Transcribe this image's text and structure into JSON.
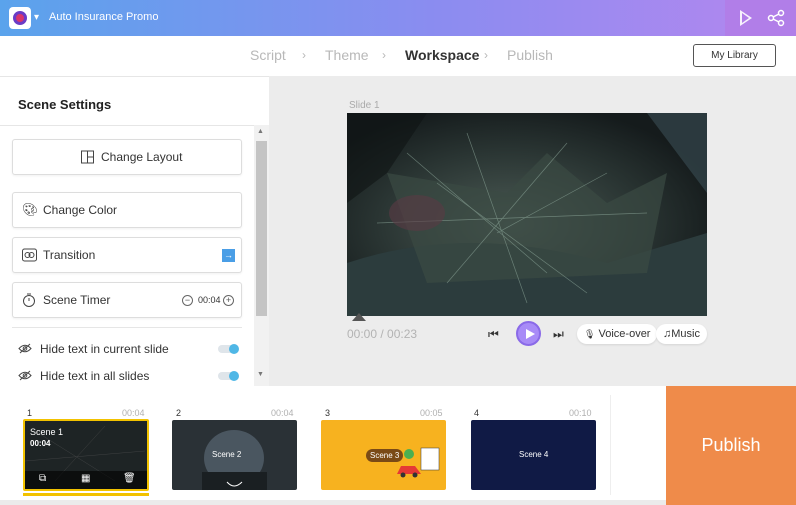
{
  "app": {
    "title": "Auto Insurance Promo"
  },
  "steps": [
    {
      "label": "Script",
      "active": false
    },
    {
      "label": "Theme",
      "active": false
    },
    {
      "label": "Workspace",
      "active": true
    },
    {
      "label": "Publish",
      "active": false
    }
  ],
  "step_separator": "›",
  "my_library": "My Library",
  "panel": {
    "title": "Scene Settings",
    "change_layout": "Change Layout",
    "change_color": "Change Color",
    "transition": "Transition",
    "scene_timer": "Scene Timer",
    "timer_value": "00:04",
    "hide_current": "Hide text in current slide",
    "hide_all": "Hide text in all slides"
  },
  "stage": {
    "slide_label": "Slide 1",
    "time": "00:00 / 00:23",
    "voice_over": "Voice-over",
    "music": "Music"
  },
  "scenes": [
    {
      "num": "1",
      "duration": "00:04",
      "caption": "Scene 1",
      "time": "00:04"
    },
    {
      "num": "2",
      "duration": "00:04",
      "caption": "Scene 2"
    },
    {
      "num": "3",
      "duration": "00:05",
      "caption": "Scene 3"
    },
    {
      "num": "4",
      "duration": "00:10",
      "caption": "Scene 4"
    }
  ],
  "publish_label": "Publish",
  "colors": {
    "accent": "#8a6ae8",
    "publish": "#ef8b4a",
    "selected": "#f2c200"
  }
}
